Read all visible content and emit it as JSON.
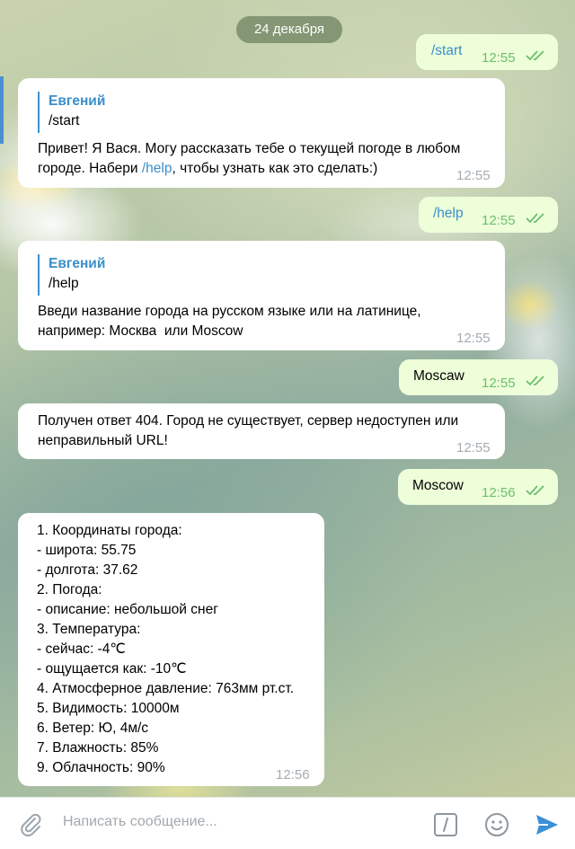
{
  "date_divider": "24 декабря",
  "messages": [
    {
      "text": "/start",
      "time": "12:55"
    },
    {
      "quote_name": "Евгений",
      "quote_text": "/start",
      "text_before": "Привет! Я Вася. Могу рассказать тебе о текущей погоде в любом городе. Набери ",
      "link": "/help",
      "text_after": ", чтобы узнать как это сделать:)",
      "time": "12:55"
    },
    {
      "text": "/help",
      "time": "12:55"
    },
    {
      "quote_name": "Евгений",
      "quote_text": "/help",
      "text": "Введи название города на русском языке или на латинице, например: Москва  или Moscow",
      "time": "12:55"
    },
    {
      "text": "Moscaw",
      "time": "12:55"
    },
    {
      "text": "Получен ответ 404. Город не существует, сервер недоступен или неправильный URL!",
      "time": "12:55"
    },
    {
      "text": "Moscow",
      "time": "12:56"
    },
    {
      "lines": [
        "1. Координаты города:",
        "- широта: 55.75",
        "- долгота: 37.62",
        "2. Погода:",
        "- описание: небольшой снег",
        "3. Температура:",
        "- сейчас: -4℃",
        "- ощущается как: -10℃",
        "4. Атмосферное давление: 763мм рт.ст.",
        "5. Видимость: 10000м",
        "6. Ветер: Ю, 4м/с",
        "7. Влажность: 85%",
        "9. Облачность: 90%"
      ],
      "time": "12:56"
    }
  ],
  "composer": {
    "placeholder": "Написать сообщение...",
    "icons": [
      "paperclip-icon",
      "command-slash-icon",
      "emoji-icon",
      "send-icon"
    ]
  },
  "colors": {
    "outgoing_bubble": "#eefed9",
    "incoming_bubble": "#ffffff",
    "accent": "#3a8fcb",
    "read_ticks": "#6bbf6e"
  }
}
